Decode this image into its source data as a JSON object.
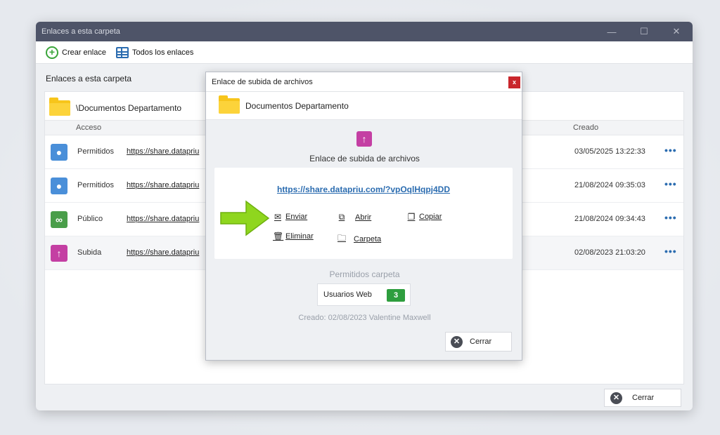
{
  "window": {
    "title": "Enlaces a esta carpeta",
    "minimize": "—",
    "maximize": "☐",
    "close": "✕"
  },
  "toolbar": {
    "create_label": "Crear enlace",
    "all_links_label": "Todos los enlaces"
  },
  "section_title": "Enlaces a esta carpeta",
  "folder_path": "\\Documentos Departamento",
  "table": {
    "headers": {
      "access": "Acceso",
      "created": "Creado"
    },
    "rows": [
      {
        "access": "Permitidos",
        "link": "https://share.datapriu",
        "created": "03/05/2025 13:22:33",
        "icon": "user-icon",
        "color": "#4a8fd9"
      },
      {
        "access": "Permitidos",
        "link": "https://share.datapriu",
        "created": "21/08/2024 09:35:03",
        "icon": "user-icon",
        "color": "#4a8fd9"
      },
      {
        "access": "Público",
        "link": "https://share.datapriu",
        "created": "21/08/2024 09:34:43",
        "icon": "link-icon",
        "color": "#4a9e4a"
      },
      {
        "access": "Subida",
        "link": "https://share.datapriu",
        "created": "02/08/2023 21:03:20",
        "icon": "upload-icon",
        "color": "#c43fa3"
      }
    ],
    "more": "•••"
  },
  "bottom_close_label": "Cerrar",
  "dialog": {
    "title": "Enlace de subida de archivos",
    "close_x": "x",
    "folder_name": "Documentos Departamento",
    "subtitle": "Enlace de subida de archivos",
    "url": "https://share.datapriu.com/?vpOqlHqpj4DD",
    "actions": {
      "send": "Enviar",
      "open": "Abrir",
      "copy": "Copiar",
      "delete": "Eliminar",
      "folder": "Carpeta"
    },
    "permitted_title": "Permitidos carpeta",
    "users_label": "Usuarios Web",
    "users_count": "3",
    "created_text": "Creado: 02/08/2023   Valentine Maxwell",
    "close_label": "Cerrar"
  },
  "colors": {
    "accent": "#2b6cb0",
    "titlebar": "#4e5468",
    "upload": "#c43fa3",
    "badge_green": "#2e9e3e",
    "arrow_green": "#8fd61e"
  }
}
